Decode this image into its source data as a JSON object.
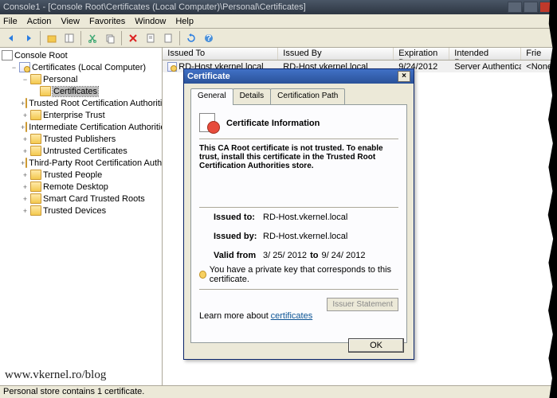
{
  "window": {
    "title": "Console1 - [Console Root\\Certificates (Local Computer)\\Personal\\Certificates]"
  },
  "menu": {
    "file": "File",
    "action": "Action",
    "view": "View",
    "favorites": "Favorites",
    "window": "Window",
    "help": "Help"
  },
  "tree": {
    "root": "Console Root",
    "certs": "Certificates (Local Computer)",
    "personal": "Personal",
    "certificates": "Certificates",
    "trca": "Trusted Root Certification Authorities",
    "et": "Enterprise Trust",
    "ica": "Intermediate Certification Authorities",
    "tp": "Trusted Publishers",
    "uc": "Untrusted Certificates",
    "tprca": "Third-Party Root Certification Authorities",
    "tpe": "Trusted People",
    "rd": "Remote Desktop",
    "sctr": "Smart Card Trusted Roots",
    "td": "Trusted Devices"
  },
  "grid": {
    "cols": {
      "issuedTo": "Issued To",
      "issuedBy": "Issued By",
      "exp": "Expiration Date",
      "purpose": "Intended Purposes",
      "friendly": "Frie"
    },
    "row": {
      "issuedTo": "RD-Host.vkernel.local",
      "issuedBy": "RD-Host.vkernel.local",
      "exp": "9/24/2012",
      "purpose": "Server Authentication",
      "friendly": "<None"
    }
  },
  "status": "Personal store contains 1 certificate.",
  "dialog": {
    "title": "Certificate",
    "tabs": {
      "general": "General",
      "details": "Details",
      "path": "Certification Path"
    },
    "heading": "Certificate Information",
    "warn": "This CA Root certificate is not trusted. To enable trust, install this certificate in the Trusted Root Certification Authorities store.",
    "issuedToLbl": "Issued to:",
    "issuedToVal": "RD-Host.vkernel.local",
    "issuedByLbl": "Issued by:",
    "issuedByVal": "RD-Host.vkernel.local",
    "validLbl": "Valid from",
    "validFrom": "3/ 25/ 2012",
    "to": "to",
    "validTo": "9/ 24/ 2012",
    "keyNote": "You have a private key that corresponds to this certificate.",
    "issuerBtn": "Issuer Statement",
    "learn": "Learn more about",
    "learnLink": "certificates",
    "ok": "OK"
  },
  "watermark": "www.vkernel.ro/blog"
}
